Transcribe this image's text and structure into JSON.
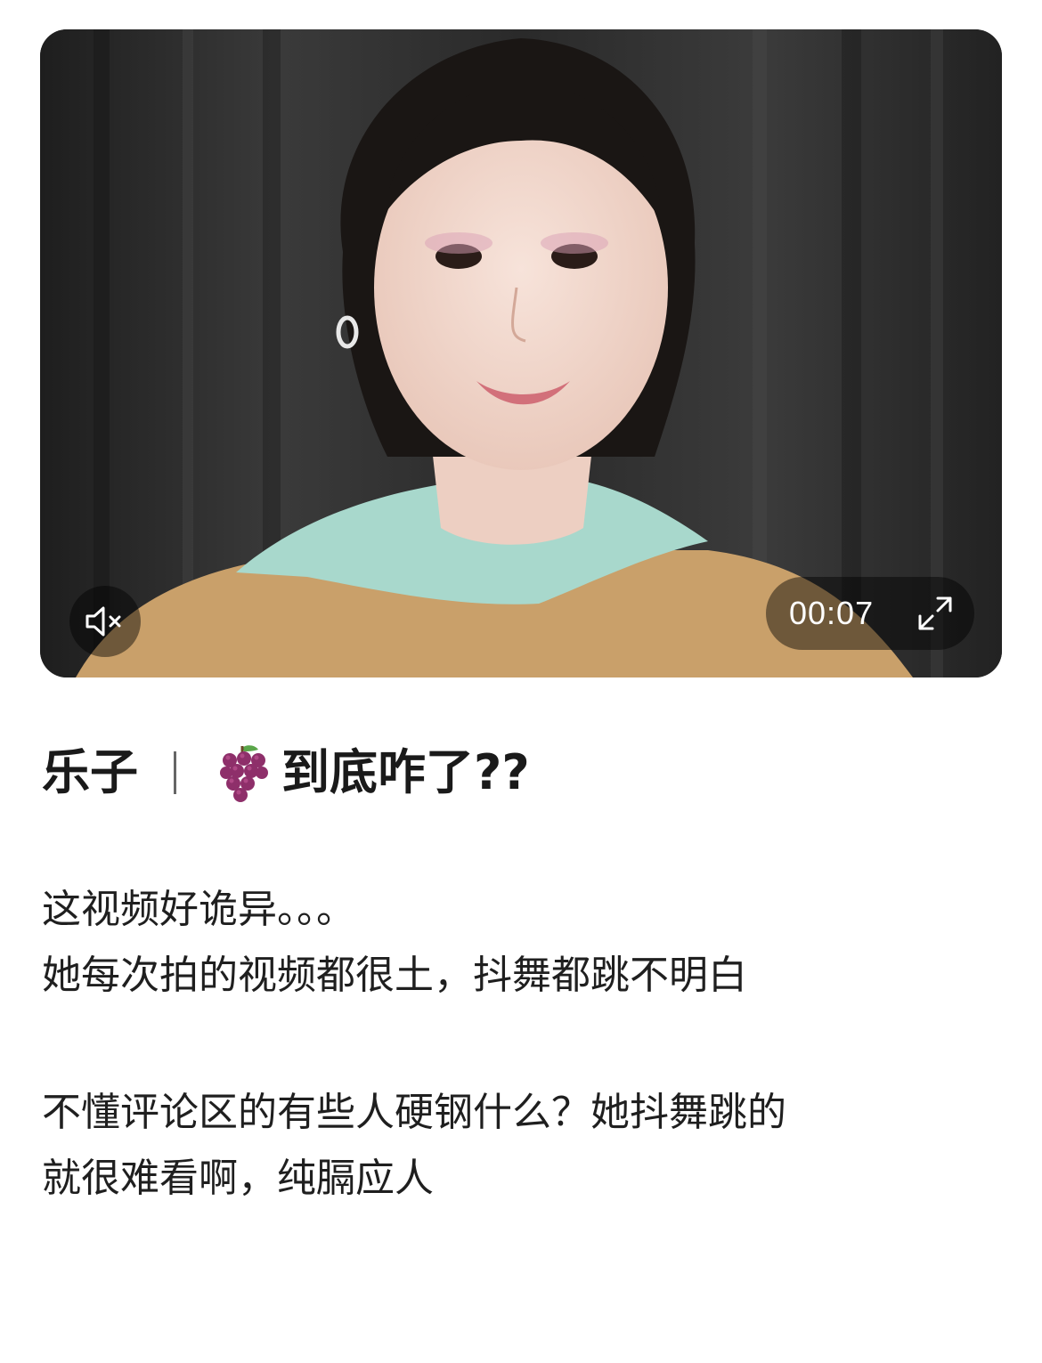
{
  "video": {
    "duration": "00:07",
    "mute_icon": "speaker-muted-icon",
    "fullscreen_icon": "expand-icon"
  },
  "post": {
    "title_prefix": "乐子",
    "title_emoji": "grape-icon",
    "title_text": "到底咋了??",
    "body": {
      "line1": "这视频好诡异。。。",
      "line2": "她每次拍的视频都很土，抖舞都跳不明白",
      "line3": "不懂评论区的有些人硬钢什么？她抖舞跳的",
      "line4": "就很难看啊，纯膈应人"
    }
  },
  "colors": {
    "overlay": "#000000",
    "text": "#1f1f1f",
    "collar": "#a8d8cc",
    "sweater": "#c9a06a"
  }
}
